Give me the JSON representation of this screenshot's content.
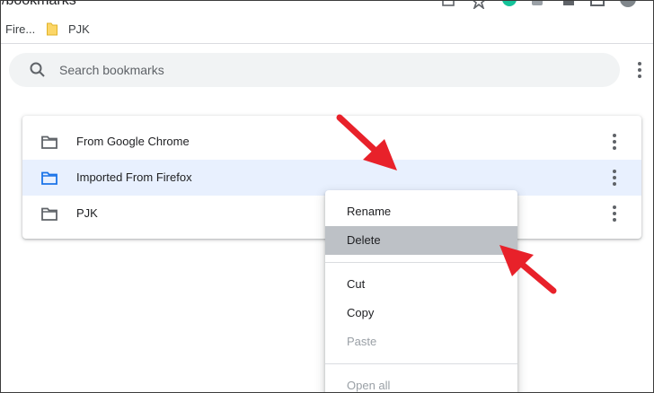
{
  "address_bar": {
    "url_fragment": "/bookmarks"
  },
  "bookmarks_bar": {
    "items": [
      {
        "label": "Fire...",
        "icon": "firefox-folder-truncated"
      },
      {
        "label": "PJK",
        "icon": "folder-icon"
      }
    ]
  },
  "search": {
    "placeholder": "Search bookmarks",
    "icon": "search-icon"
  },
  "folders": [
    {
      "label": "From Google Chrome",
      "selected": false
    },
    {
      "label": "Imported From Firefox",
      "selected": true
    },
    {
      "label": "PJK",
      "selected": false
    }
  ],
  "context_menu": {
    "items": [
      {
        "label": "Rename",
        "state": "normal"
      },
      {
        "label": "Delete",
        "state": "hover"
      },
      {
        "label": "Cut",
        "state": "normal"
      },
      {
        "label": "Copy",
        "state": "normal"
      },
      {
        "label": "Paste",
        "state": "disabled"
      },
      {
        "label": "Open all",
        "state": "disabled"
      }
    ]
  },
  "colors": {
    "selected_row": "#e8f0fe",
    "folder_selected": "#1a73e8",
    "menu_hover": "#bdc1c6",
    "annotation_arrow": "#e8212a"
  }
}
